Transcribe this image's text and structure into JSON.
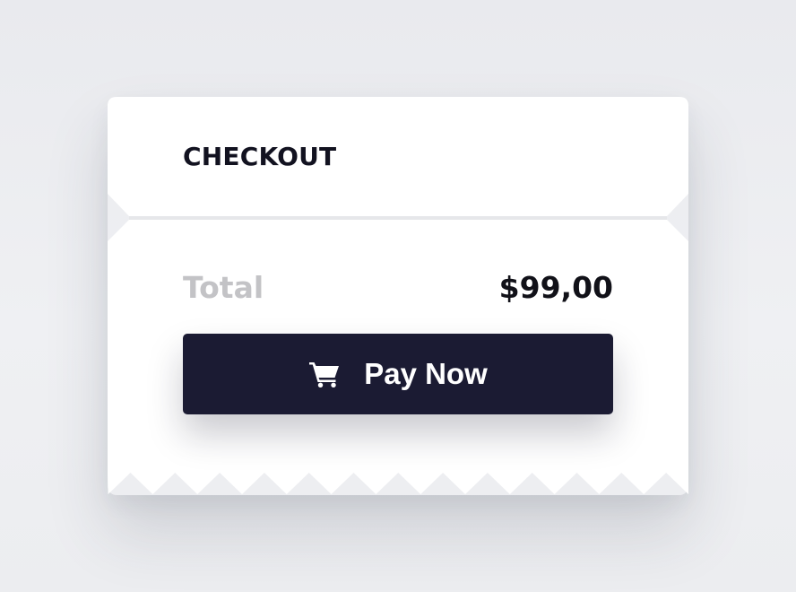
{
  "checkout": {
    "title": "CHECKOUT",
    "total_label": "Total",
    "total_amount": "$99,00",
    "pay_button_label": "Pay Now",
    "pay_button_icon": "shopping-cart-icon"
  },
  "colors": {
    "background": "#eceef1",
    "card": "#ffffff",
    "divider": "#e6e7ea",
    "button": "#1b1b33",
    "title_text": "#121220",
    "muted_text": "#c3c3c6",
    "amount_text": "#111118",
    "button_text": "#ffffff"
  }
}
